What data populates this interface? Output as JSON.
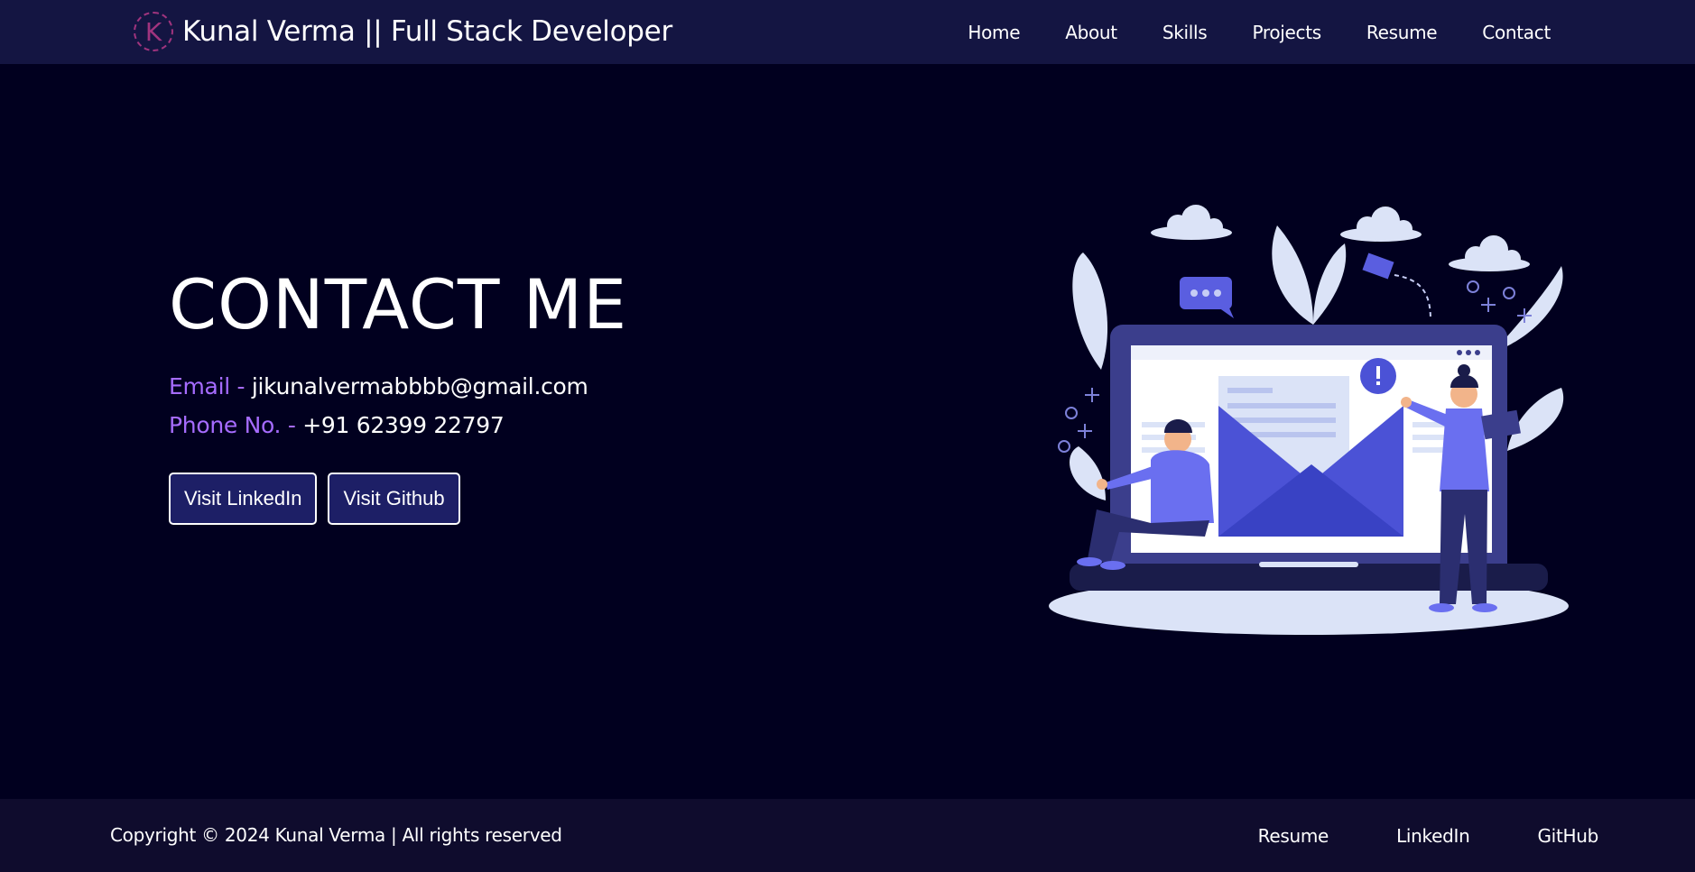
{
  "header": {
    "logo_letter": "K",
    "brand": "Kunal Verma || Full Stack Developer",
    "nav": [
      "Home",
      "About",
      "Skills",
      "Projects",
      "Resume",
      "Contact"
    ]
  },
  "contact": {
    "title": "CONTACT ME",
    "email_label": "Email -",
    "email": "jikunalvermabbbb@gmail.com",
    "phone_label": "Phone No. -",
    "phone": "+91 62399 22797",
    "buttons": [
      "Visit LinkedIn",
      "Visit Github"
    ]
  },
  "illustration": {
    "icon": "contact-email-illustration-icon"
  },
  "footer": {
    "copyright": "Copyright © 2024 Kunal Verma | All rights reserved",
    "links": [
      "Resume",
      "LinkedIn",
      "GitHub"
    ]
  },
  "colors": {
    "background": "#01001f",
    "navbar": "#141542",
    "footer": "#0f0c2d",
    "accent_purple": "#a66cff",
    "button_bg": "#1d1f66",
    "illustration_blue": "#5a5ee0"
  }
}
